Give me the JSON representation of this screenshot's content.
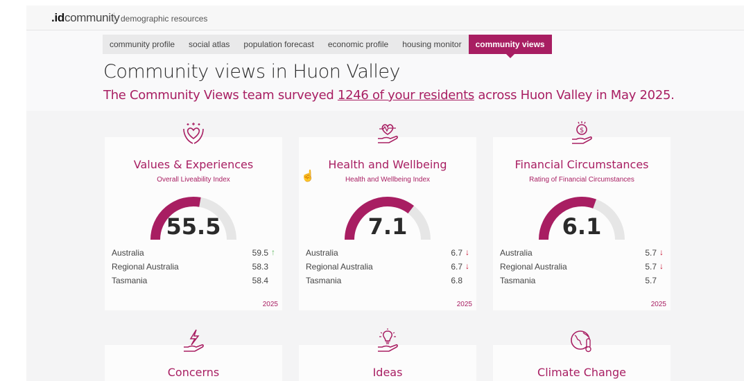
{
  "topbar": {
    "menu_icon": "hamburger-menu-icon",
    "logo_prefix": ".",
    "logo_bold": "id",
    "logo_rest": "community",
    "logo_tagline": "demographic resources"
  },
  "nav": {
    "tabs": [
      {
        "label": "community profile",
        "active": false
      },
      {
        "label": "social atlas",
        "active": false
      },
      {
        "label": "population forecast",
        "active": false
      },
      {
        "label": "economic profile",
        "active": false
      },
      {
        "label": "housing monitor",
        "active": false
      },
      {
        "label": "community views",
        "active": true
      }
    ]
  },
  "header": {
    "title": "Community views in Huon Valley",
    "subtitle_before": "The Community Views team surveyed ",
    "subtitle_link": "1246 of your residents",
    "subtitle_after": " across Huon Valley in May 2025."
  },
  "colors": {
    "accent": "#a81e62",
    "gauge_track": "#e6e6e6",
    "up": "#5cb85c",
    "down": "#c8102e"
  },
  "cards": [
    {
      "icon": "heart-hands-icon",
      "title": "Values & Experiences",
      "subtitle": "Overall Liveability Index",
      "value": "55.5",
      "gauge_fraction": 0.555,
      "comparisons": [
        {
          "label": "Australia",
          "value": "59.5",
          "trend": "up"
        },
        {
          "label": "Regional Australia",
          "value": "58.3",
          "trend": "none"
        },
        {
          "label": "Tasmania",
          "value": "58.4",
          "trend": "none"
        }
      ],
      "year": "2025"
    },
    {
      "icon": "heartbeat-hand-icon",
      "title": "Health and Wellbeing",
      "subtitle": "Health and Wellbeing Index",
      "value": "7.1",
      "gauge_fraction": 0.71,
      "comparisons": [
        {
          "label": "Australia",
          "value": "6.7",
          "trend": "down"
        },
        {
          "label": "Regional Australia",
          "value": "6.7",
          "trend": "down"
        },
        {
          "label": "Tasmania",
          "value": "6.8",
          "trend": "none"
        }
      ],
      "year": "2025"
    },
    {
      "icon": "money-hand-icon",
      "title": "Financial Circumstances",
      "subtitle": "Rating of Financial Circumstances",
      "value": "6.1",
      "gauge_fraction": 0.61,
      "comparisons": [
        {
          "label": "Australia",
          "value": "5.7",
          "trend": "down"
        },
        {
          "label": "Regional Australia",
          "value": "5.7",
          "trend": "down"
        },
        {
          "label": "Tasmania",
          "value": "5.7",
          "trend": "none"
        }
      ],
      "year": "2025"
    }
  ],
  "bottom_cards": [
    {
      "icon": "lightning-hand-icon",
      "title": "Concerns"
    },
    {
      "icon": "lightbulb-hand-icon",
      "title": "Ideas"
    },
    {
      "icon": "globe-thermometer-icon",
      "title": "Climate Change"
    }
  ]
}
